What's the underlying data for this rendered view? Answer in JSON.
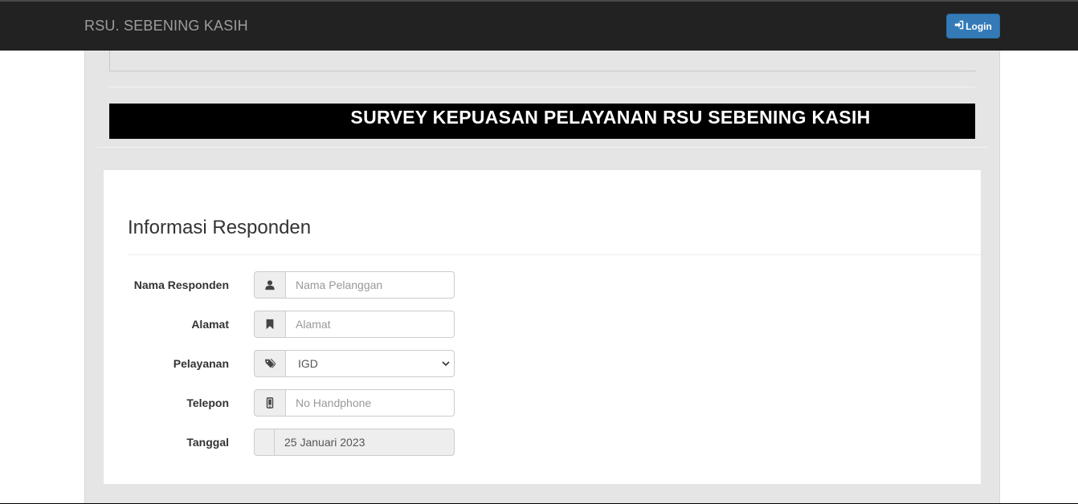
{
  "navbar": {
    "brand": "RSU. SEBENING KASIH",
    "login_label": "Login",
    "login_icon": "sign-in-icon"
  },
  "banner": {
    "text": "SURVEY KEPUASAN PELAYANAN RSU SEBENING KASIH"
  },
  "form": {
    "title": "Informasi Responden",
    "fields": [
      {
        "label": "Nama Responden",
        "icon": "user-icon",
        "placeholder": "Nama Pelanggan",
        "value": ""
      },
      {
        "label": "Alamat",
        "icon": "bookmark-icon",
        "placeholder": "Alamat",
        "value": ""
      },
      {
        "label": "Pelayanan",
        "icon": "tags-icon",
        "selected": "IGD"
      },
      {
        "label": "Telepon",
        "icon": "phone-icon",
        "placeholder": "No Handphone",
        "value": ""
      },
      {
        "label": "Tanggal",
        "value": "25 Januari 2023"
      }
    ]
  },
  "colors": {
    "navbar_bg": "#222222",
    "login_btn": "#337ab7",
    "page_bg": "#e5e5e5",
    "banner_bg": "#000000"
  }
}
